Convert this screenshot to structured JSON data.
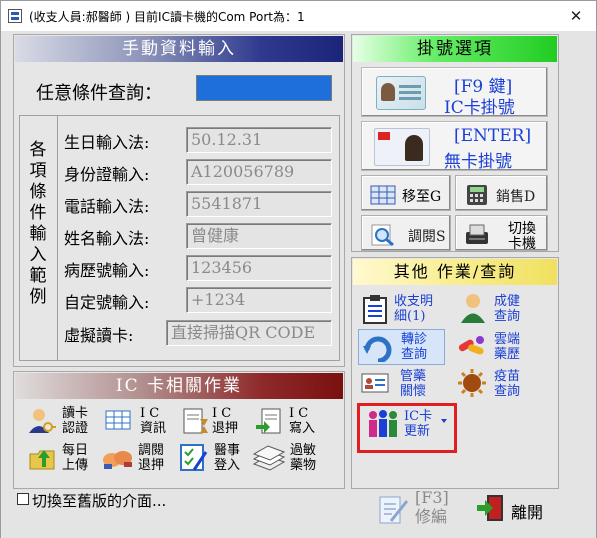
{
  "window": {
    "title": "(收支人員:郝醫師 ) 目前IC讀卡機的Com Port為：1",
    "close_glyph": "✕"
  },
  "manual_panel": {
    "header": "手動資料輸入",
    "query_label": "任意條件查詢：",
    "query_value": "",
    "side_label": [
      "各",
      "項",
      "條",
      "件",
      "輸",
      "入",
      "範",
      "例"
    ],
    "rows": [
      {
        "label": "生日輸入法:",
        "value": "50.12.31"
      },
      {
        "label": "身份證輸入:",
        "value": "A120056789"
      },
      {
        "label": "電話輸入法:",
        "value": "5541871"
      },
      {
        "label": "姓名輸入法:",
        "value": "曾健康"
      },
      {
        "label": "病歷號輸入:",
        "value": "123456"
      },
      {
        "label": "自定號輸入:",
        "value": "+1234"
      },
      {
        "label": "虛擬讀卡:",
        "value": "直接掃描QR CODE"
      }
    ]
  },
  "ic_panel": {
    "header": "IC 卡相關作業",
    "tools": [
      {
        "name": "card-auth",
        "line1": "讀卡",
        "line2": "認證",
        "icon": "person-key-icon"
      },
      {
        "name": "ic-info",
        "line1": "I C",
        "line2": "資訊",
        "icon": "table-icon"
      },
      {
        "name": "ic-return",
        "line1": "I C",
        "line2": "退押",
        "icon": "hourglass-doc-icon"
      },
      {
        "name": "ic-write",
        "line1": "I C",
        "line2": "寫入",
        "icon": "write-doc-icon"
      },
      {
        "name": "daily-upload",
        "line1": "每日",
        "line2": "上傳",
        "icon": "upload-folder-icon"
      },
      {
        "name": "adjust-return",
        "line1": "調閱",
        "line2": "退押",
        "icon": "handshake-icon"
      },
      {
        "name": "doctor-login",
        "line1": "醫事",
        "line2": "登入",
        "icon": "checklist-icon"
      },
      {
        "name": "allergy-drug",
        "line1": "過敏",
        "line2": "藥物",
        "icon": "book-stack-icon"
      }
    ]
  },
  "register_panel": {
    "header": "掛號選項",
    "ic_register": {
      "line1": "[F9 鍵]",
      "line2": "IC卡掛號"
    },
    "noic_register": {
      "line1": "[ENTER]",
      "line2": "無卡掛號"
    },
    "move_out": "移至G",
    "sales": "銷售D",
    "review": "調閱S",
    "switch_card_1": "切換",
    "switch_card_2": "卡機"
  },
  "other_panel": {
    "header": "其他 作業/查詢",
    "items": [
      {
        "line1": "收支明",
        "line2": "細(1)",
        "icon": "clipboard-icon"
      },
      {
        "line1": "成健",
        "line2": "查詢",
        "icon": "person-icon"
      },
      {
        "line1": "轉診",
        "line2": "查詢",
        "icon": "refresh-arrow-icon"
      },
      {
        "line1": "雲端",
        "line2": "藥歷",
        "icon": "pills-icon"
      },
      {
        "line1": "管藥",
        "line2": "關懷",
        "icon": "id-card-icon"
      },
      {
        "line1": "疫苗",
        "line2": "查詢",
        "icon": "virus-icon"
      },
      {
        "line1": "IC卡",
        "line2": "更新",
        "icon": "people-icon"
      }
    ]
  },
  "footer": {
    "old_ui_checkbox": "切換至舊版的介面...",
    "edit_line1": "[F3]",
    "edit_line2": "修編",
    "exit_label": "離開"
  },
  "colors": {
    "blue_text": "#1a40d6",
    "highlight_border": "#e02020",
    "query_field": "#1e6fd9"
  }
}
